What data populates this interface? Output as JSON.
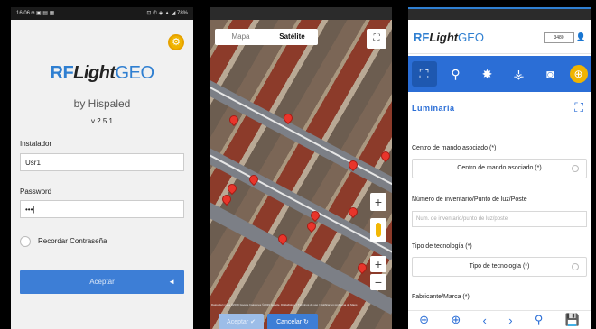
{
  "phone1": {
    "status": {
      "left": "16:06 ◘ ▣ ▤ ▦",
      "right": "⊡ ✆ ◈ ▲ ◢ 78%"
    },
    "logo": {
      "rf": "RF",
      "light": "Light",
      "geo": "GEO"
    },
    "by": "by Hispaled",
    "version": "v 2.5.1",
    "installer_label": "Instalador",
    "installer_value": "Usr1",
    "password_label": "Password",
    "password_value": "•••|",
    "remember_label": "Recordar Contraseña",
    "accept_label": "Aceptar",
    "accept_icon": "◄"
  },
  "phone2": {
    "tabs": [
      "Mapa",
      "Satélite"
    ],
    "active_tab": "Satélite",
    "fullscreen_icon": "⛶",
    "zoom_in": "+",
    "zoom_out": "−",
    "zoom_in_top": "+",
    "zoom_out_top": "−",
    "attribution": "Datos del mapa ©2019 Google Imágenes ©2019 Google, DigitalGlobe | Términos de uso | Notificar un problema de Maps",
    "accept_label": "Aceptar ✔",
    "cancel_label": "Cancelar ↻"
  },
  "phone3": {
    "logo": {
      "rf": "RF",
      "light": "Light",
      "geo": "GEO"
    },
    "user_box": "3480",
    "user_icon": "👤",
    "toolbar_icons": [
      "⛶",
      "⚲",
      "✸",
      "⚶",
      "◙",
      "⊕"
    ],
    "section_title": "Luminaria",
    "section_icon": "⛶",
    "label_centro": "Centro de mando asociado (*)",
    "select_centro": "Centro de mando asociado (*)",
    "label_inventario": "Número de inventario/Punto de luz/Poste",
    "placeholder_inventario": "Num. de inventario/punto de luz/poste",
    "label_tecnologia": "Tipo de tecnología (*)",
    "select_tecnologia": "Tipo de tecnología (*)",
    "label_fabricante": "Fabricante/Marca (*)",
    "bottom_icons": [
      "⊕",
      "⊕",
      "‹",
      "›",
      "⚲",
      "💾"
    ]
  },
  "colors": {
    "accent": "#2b6ed6",
    "pin": "#e8352b",
    "gear": "#f0b400"
  }
}
